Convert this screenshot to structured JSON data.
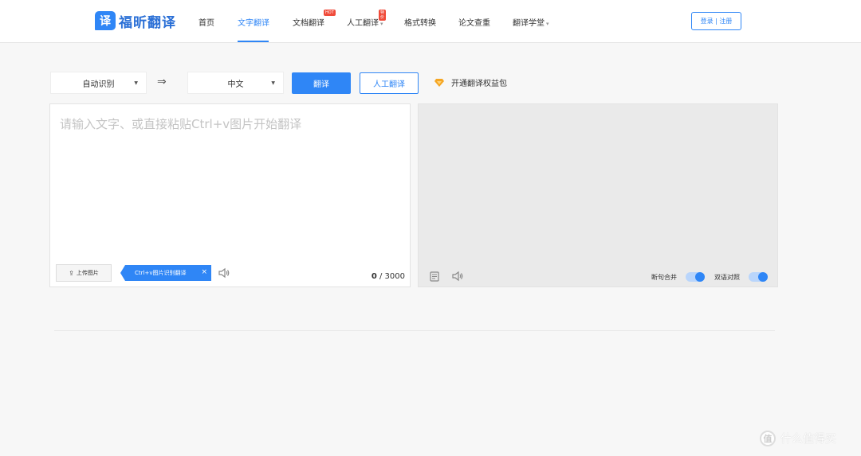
{
  "header": {
    "logo_glyph": "译",
    "logo_text": "福昕翻译",
    "nav": [
      {
        "label": "首页"
      },
      {
        "label": "文字翻译",
        "active": true
      },
      {
        "label": "文档翻译",
        "badge": "HOT"
      },
      {
        "label": "人工翻译",
        "badge": "特价"
      },
      {
        "label": "格式转换"
      },
      {
        "label": "论文查重"
      },
      {
        "label": "翻译学堂"
      }
    ],
    "login_label": "登录 | 注册"
  },
  "toolbar": {
    "source_lang": "自动识别",
    "target_lang": "中文",
    "swap_icon": "⇒",
    "translate_label": "翻译",
    "human_label": "人工翻译",
    "promo_label": "开通翻译权益包"
  },
  "source_panel": {
    "placeholder": "请输入文字、或直接粘贴Ctrl+v图片开始翻译",
    "upload_label": "上传图片",
    "tip_label": "Ctrl+v图片识别翻译",
    "tip_close": "×",
    "count_current": "0",
    "count_sep": " / ",
    "count_max": "3000"
  },
  "target_panel": {
    "toggle_merge_label": "断句合并",
    "toggle_bilingual_label": "双语对照"
  },
  "watermark": {
    "icon_text": "值",
    "text": "什么值得买"
  },
  "colors": {
    "accent": "#2f86f6",
    "hot_badge": "#f04b3a",
    "promo_icon": "#f5a623"
  }
}
